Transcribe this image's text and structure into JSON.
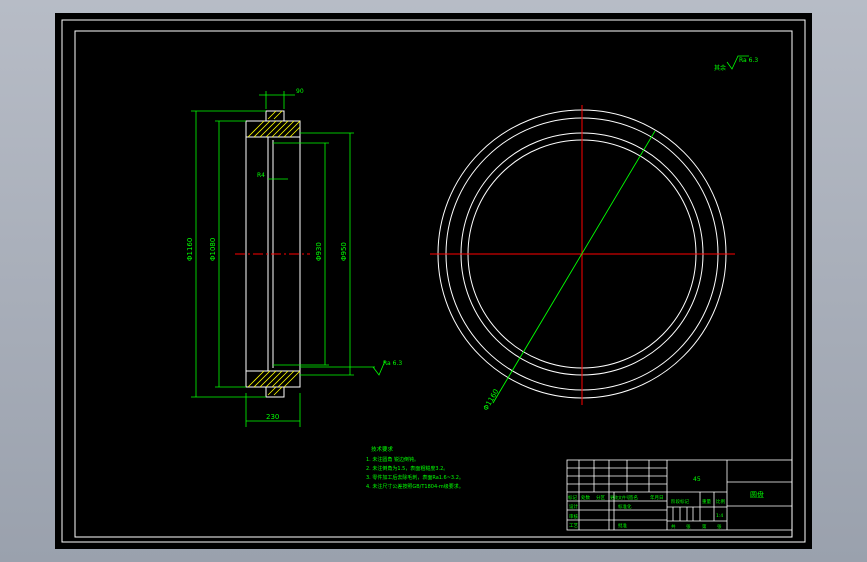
{
  "colors": {
    "background": "#000000",
    "outline": "#ffffff",
    "dimension": "#00ff00",
    "centerline": "#ff0000",
    "hatch": "#ffff00",
    "chrome": "#a7adb8"
  },
  "section_view": {
    "dim_overall_outer": "Φ1160",
    "dim_outer": "Φ1080",
    "dim_bore": "Φ930",
    "dim_inner": "Φ950",
    "dim_width": "230",
    "dim_rib": "90",
    "dim_groove": "R4",
    "roughness": "Ra 6.3"
  },
  "front_view": {
    "dim_diameter": "Φ1160"
  },
  "general_roughness": {
    "prefix": "其余",
    "value": "Ra 6.3"
  },
  "tech_requirements": {
    "heading": "技术要求",
    "items": [
      "1. 未注圆角 锐边倒钝。",
      "2. 未注倒角为1.5，表面粗糙度3.2。",
      "3. 零件加工后去除毛刺，表面Ra1.6~3.2。",
      "4. 未注尺寸公差按照GB/T1804-m级要求。"
    ]
  },
  "title_block": {
    "material": "45",
    "part_name": "圆盘",
    "col_labels": [
      "标记",
      "处数",
      "分区",
      "更改文件号",
      "签名",
      "年月日"
    ],
    "row_labels": [
      "设计",
      "审核",
      "工艺"
    ],
    "stage_label": "阶段标记",
    "weight_label": "重量",
    "scale_label": "比例",
    "scale_value": "1:4",
    "sheet_labels": [
      "共",
      "张",
      "第",
      "张"
    ],
    "approve_label": "批准",
    "std_label": "标准化"
  }
}
